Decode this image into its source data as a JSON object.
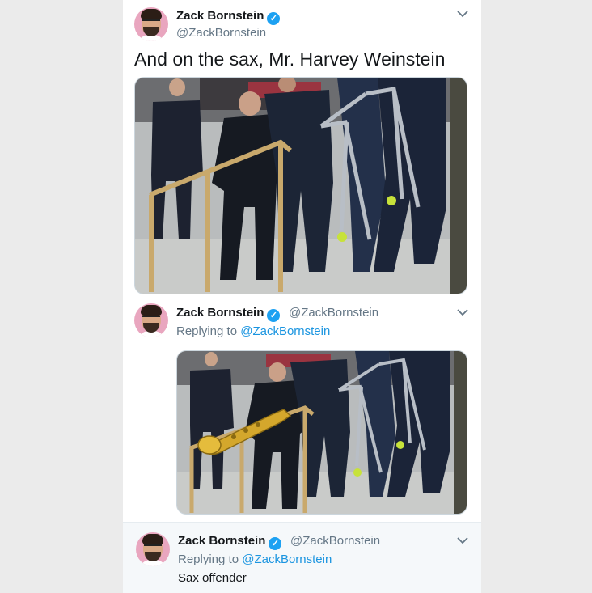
{
  "tweets": [
    {
      "name": "Zack Bornstein",
      "handle": "@ZackBornstein",
      "text": "And on the sax, Mr. Harvey Weinstein"
    },
    {
      "name": "Zack Bornstein",
      "handle": "@ZackBornstein",
      "replying_label": "Replying to",
      "replying_to": "@ZackBornstein"
    },
    {
      "name": "Zack Bornstein",
      "handle": "@ZackBornstein",
      "replying_label": "Replying to",
      "replying_to": "@ZackBornstein",
      "text": "Sax offender"
    }
  ],
  "icons": {
    "verified": "verified-badge-icon",
    "menu": "chevron-down-icon"
  },
  "colors": {
    "link": "#1b95e0",
    "verified": "#1da1f2",
    "avatar_bg": "#e9a6bf"
  }
}
